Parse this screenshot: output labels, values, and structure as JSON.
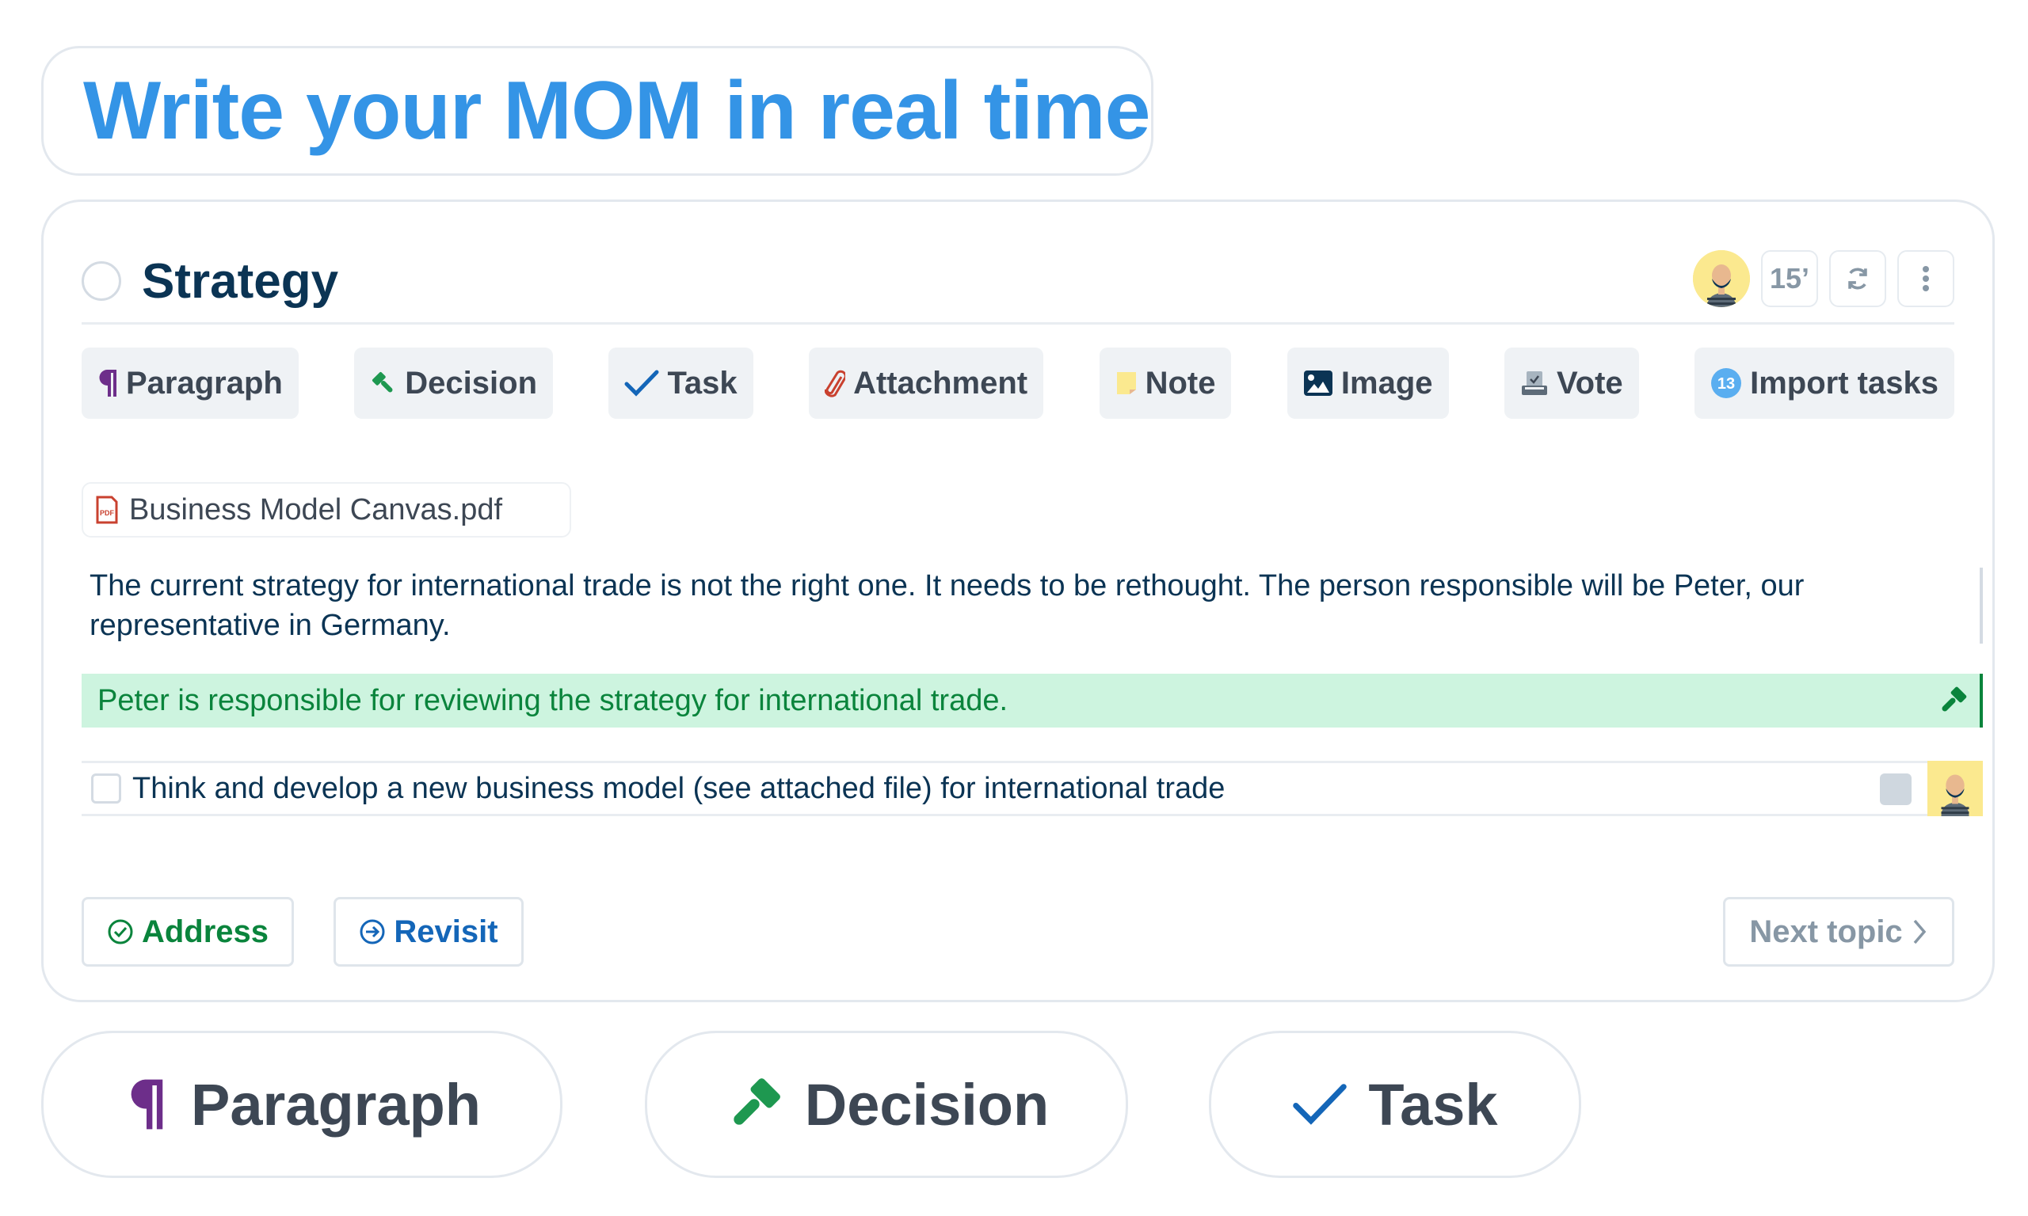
{
  "headline": "Write your MOM in real time",
  "topic": {
    "title": "Strategy",
    "duration": "15’",
    "owner_avatar": "bearded-man-avatar"
  },
  "toolbar": {
    "items": [
      {
        "label": "Paragraph",
        "icon": "pilcrow-icon"
      },
      {
        "label": "Decision",
        "icon": "gavel-icon"
      },
      {
        "label": "Task",
        "icon": "checkmark-icon"
      },
      {
        "label": "Attachment",
        "icon": "paperclip-icon"
      },
      {
        "label": "Note",
        "icon": "sticky-note-icon"
      },
      {
        "label": "Image",
        "icon": "image-icon"
      },
      {
        "label": "Vote",
        "icon": "ballot-box-icon"
      },
      {
        "label": "Import tasks",
        "icon": "count-badge",
        "badge": "13"
      }
    ]
  },
  "content": {
    "attachment": {
      "name": "Business Model Canvas.pdf",
      "icon": "pdf-icon",
      "icon_text": "PDF"
    },
    "paragraph": "The current strategy for international trade is not the right one. It needs to be rethought. The person responsible will be Peter, our representative in Germany.",
    "decision": "Peter is responsible for reviewing the strategy for international trade.",
    "task": {
      "text": "Think and develop a new business model (see attached file) for international trade",
      "checked": false
    }
  },
  "footer": {
    "address_label": "Address",
    "revisit_label": "Revisit",
    "next_label": "Next topic"
  },
  "pills": [
    {
      "label": "Paragraph"
    },
    {
      "label": "Decision"
    },
    {
      "label": "Task"
    }
  ],
  "colors": {
    "headline": "#3494e6",
    "title": "#0b3454",
    "decision_bg": "#cdf4df",
    "decision_text": "#0a843c",
    "paragraph_icon": "#6d2e8a",
    "task_icon": "#1466b8",
    "attachment_icon": "#c9412f"
  }
}
